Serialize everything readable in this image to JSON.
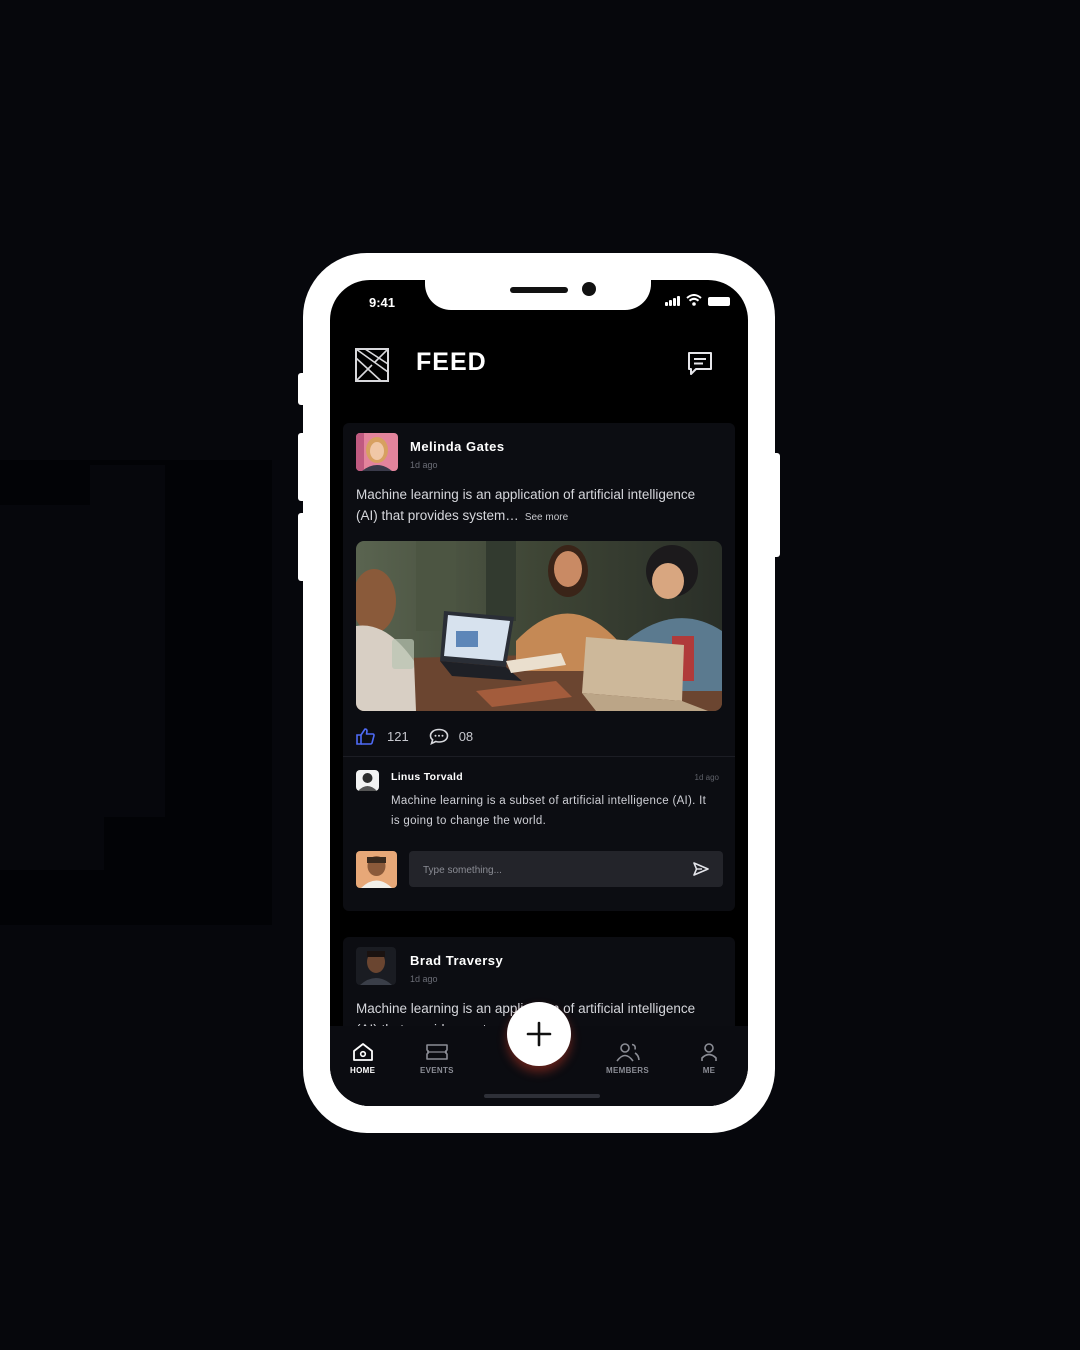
{
  "status_bar": {
    "time": "9:41"
  },
  "header": {
    "title": "FEED"
  },
  "posts": [
    {
      "author": "Melinda Gates",
      "time": "1d ago",
      "text": "Machine learning is an application of artificial intelligence (AI) that provides system…",
      "see_more": "See more",
      "likes": "121",
      "comments": "08",
      "comment": {
        "author": "Linus Torvald",
        "time": "1d ago",
        "text": "Machine learning is a subset of artificial intelligence (AI). It is going to change the world."
      },
      "compose_placeholder": "Type something..."
    },
    {
      "author": "Brad Traversy",
      "time": "1d ago",
      "text": "Machine learning is an application of artificial intelligence (AI) that provides system"
    }
  ],
  "bottom_nav": [
    {
      "label": "HOME",
      "icon": "home-icon",
      "active": true
    },
    {
      "label": "EVENTS",
      "icon": "ticket-icon",
      "active": false
    },
    {
      "label": "MEMBERS",
      "icon": "members-icon",
      "active": false
    },
    {
      "label": "ME",
      "icon": "profile-icon",
      "active": false
    }
  ],
  "colors": {
    "background": "#06070c",
    "phone_frame": "#ffffff",
    "screen": "#000000",
    "card": "#0c0d12",
    "like_accent": "#4f6bf6",
    "fab_glow": "#d23c28"
  }
}
